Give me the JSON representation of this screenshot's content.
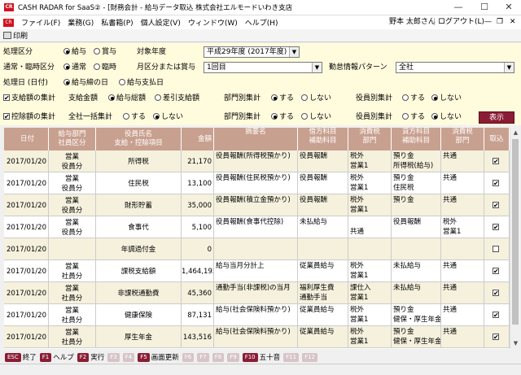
{
  "window": {
    "app_badge": "CR",
    "title": "CASH RADAR for SaaS② - [財務会計 - 給与データ取込 株式会社エルモードいわき支店",
    "minimize": "—",
    "maximize": "☐",
    "close": "✕"
  },
  "menu": {
    "badge": "CR",
    "items": [
      "ファイル(F)",
      "業務(G)",
      "私書箱(P)",
      "個人設定(V)",
      "ウィンドウ(W)",
      "ヘルプ(H)"
    ],
    "user": "野本 太郎さん",
    "logout": "ログアウト(L)",
    "sub_min": "—",
    "sub_max": "❐",
    "sub_close": "✕"
  },
  "toolbar": {
    "print_label": "印刷"
  },
  "criteria": {
    "kubun_label": "処理区分",
    "kubun_opt1": "給与",
    "kubun_opt2": "賞与",
    "year_label": "対象年度",
    "year_value": "平成29年度 (2017年度)",
    "regular_label": "通常・臨時区分",
    "regular_opt1": "通常",
    "regular_opt2": "臨時",
    "month_label": "月区分または賞与",
    "month_value": "1回目",
    "pattern_label": "勤怠情報パターン",
    "pattern_value": "全社",
    "date_label": "処理日 (日付)",
    "date_opt1": "給与締の日",
    "date_opt2": "給与支払日",
    "pay_check": "支給額の集計",
    "pay_amount_label": "支給金額",
    "pay_amount_opt1": "給与総額",
    "pay_amount_opt2": "差引支給額",
    "dept_sum_label": "部門別集計",
    "yes": "する",
    "no": "しない",
    "officer_sum_label": "役員別集計",
    "deduct_check": "控除額の集計",
    "company_sum_label": "全社一括集計",
    "display_button": "表示"
  },
  "table": {
    "headers": [
      [
        "日付"
      ],
      [
        "給与部門",
        "社員区分"
      ],
      [
        "役員氏名",
        "支給・控除項目"
      ],
      [
        "金額"
      ],
      [
        "摘要名"
      ],
      [
        "借方科目",
        "補助科目"
      ],
      [
        "消費税",
        "部門"
      ],
      [
        "貸方科目",
        "補助科目"
      ],
      [
        "消費税",
        "部門"
      ],
      [
        "取込"
      ]
    ],
    "rows": [
      {
        "date": "2017/01/20",
        "dept": "営業",
        "emp": "役員分",
        "name": "所得税",
        "amount": "21,170",
        "summary": "役員報酬(所得税預かり)",
        "debit": "役員報酬",
        "debit_sub": "",
        "dtax": "税外",
        "ddept": "営業1",
        "credit": "預り金",
        "credit_sub": "所得税(給与)",
        "ctax": "共通",
        "cdept": "",
        "checked": true
      },
      {
        "date": "2017/01/20",
        "dept": "営業",
        "emp": "役員分",
        "name": "住民税",
        "amount": "13,100",
        "summary": "役員報酬(住民税預かり)",
        "debit": "役員報酬",
        "debit_sub": "",
        "dtax": "税外",
        "ddept": "営業1",
        "credit": "預り金",
        "credit_sub": "住民税",
        "ctax": "共通",
        "cdept": "",
        "checked": true
      },
      {
        "date": "2017/01/20",
        "dept": "営業",
        "emp": "役員分",
        "name": "財形貯蓄",
        "amount": "35,000",
        "summary": "役員報酬(積立金預かり)",
        "debit": "役員報酬",
        "debit_sub": "",
        "dtax": "税外",
        "ddept": "営業1",
        "credit": "預り金",
        "credit_sub": "",
        "ctax": "共通",
        "cdept": "",
        "checked": true
      },
      {
        "date": "2017/01/20",
        "dept": "営業",
        "emp": "役員分",
        "name": "食事代",
        "amount": "5,100",
        "summary": "役員報酬(食事代控除)",
        "debit": "未払給与",
        "debit_sub": "",
        "dtax": "",
        "ddept": "共通",
        "credit": "役員報酬",
        "credit_sub": "",
        "ctax": "税外",
        "cdept": "営業1",
        "checked": true
      },
      {
        "date": "2017/01/20",
        "dept": "",
        "emp": "",
        "name": "年調過付金",
        "amount": "0",
        "summary": "",
        "debit": "",
        "debit_sub": "",
        "dtax": "",
        "ddept": "",
        "credit": "",
        "credit_sub": "",
        "ctax": "",
        "cdept": "",
        "checked": false
      },
      {
        "date": "2017/01/20",
        "dept": "営業",
        "emp": "社員分",
        "name": "課税支給額",
        "amount": "1,464,192",
        "summary": "給与当月分計上",
        "debit": "従業員給与",
        "debit_sub": "",
        "dtax": "税外",
        "ddept": "営業1",
        "credit": "未払給与",
        "credit_sub": "",
        "ctax": "共通",
        "cdept": "",
        "checked": true
      },
      {
        "date": "2017/01/20",
        "dept": "営業",
        "emp": "社員分",
        "name": "非課税通勤費",
        "amount": "45,360",
        "summary": "通勤手当(非課税)の当月",
        "debit": "福利厚生費",
        "debit_sub": "通勤手当",
        "dtax": "課仕入",
        "ddept": "営業1",
        "credit": "未払給与",
        "credit_sub": "",
        "ctax": "共通",
        "cdept": "",
        "checked": true
      },
      {
        "date": "2017/01/20",
        "dept": "営業",
        "emp": "社員分",
        "name": "健康保険",
        "amount": "87,131",
        "summary": "給与(社会保険料預かり)",
        "debit": "従業員給与",
        "debit_sub": "",
        "dtax": "税外",
        "ddept": "営業1",
        "credit": "預り金",
        "credit_sub": "健保・厚生年金",
        "ctax": "共通",
        "cdept": "",
        "checked": true
      },
      {
        "date": "2017/01/20",
        "dept": "営業",
        "emp": "社員分",
        "name": "厚生年金",
        "amount": "143,516",
        "summary": "給与(社会保険料預かり)",
        "debit": "従業員給与",
        "debit_sub": "",
        "dtax": "税外",
        "ddept": "営業1",
        "credit": "預り金",
        "credit_sub": "健保・厚生年金",
        "ctax": "共通",
        "cdept": "",
        "checked": true
      }
    ]
  },
  "fkeys": [
    {
      "key": "ESC",
      "label": "終了",
      "active": true
    },
    {
      "key": "F1",
      "label": "ヘルプ",
      "active": true
    },
    {
      "key": "F2",
      "label": "実行",
      "active": true
    },
    {
      "key": "F3",
      "label": "",
      "active": false
    },
    {
      "key": "F4",
      "label": "",
      "active": false
    },
    {
      "key": "F5",
      "label": "画面更新",
      "active": true
    },
    {
      "key": "F6",
      "label": "",
      "active": false
    },
    {
      "key": "F7",
      "label": "",
      "active": false
    },
    {
      "key": "F8",
      "label": "",
      "active": false
    },
    {
      "key": "F9",
      "label": "",
      "active": false
    },
    {
      "key": "F10",
      "label": "五十音",
      "active": true
    },
    {
      "key": "F11",
      "label": "",
      "active": false
    },
    {
      "key": "F12",
      "label": "",
      "active": false
    }
  ],
  "colors": {
    "accent": "#8b1c35",
    "header": "#c8a08f",
    "row_alt": "#f5f1dd",
    "criteria_bg": "#fffbdd"
  }
}
